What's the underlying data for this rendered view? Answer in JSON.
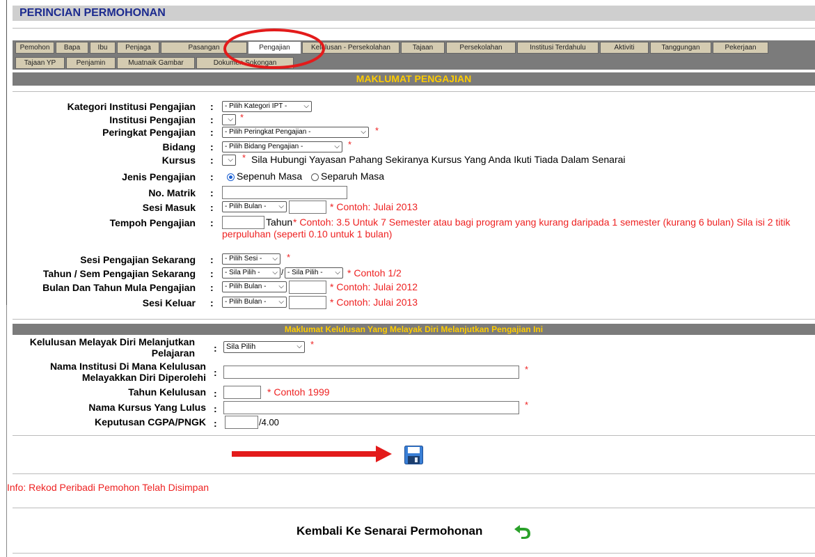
{
  "header": {
    "title": "PERINCIAN PERMOHONAN"
  },
  "tabs": {
    "row1": [
      "Pemohon",
      "Bapa",
      "Ibu",
      "Penjaga",
      "Pasangan",
      "Pengajian",
      "Kelulusan - Persekolahan",
      "Tajaan",
      "Persekolahan",
      "Institusi Terdahulu",
      "Aktiviti",
      "Tanggungan",
      "Pekerjaan"
    ],
    "row2": [
      "Tajaan YP",
      "Penjamin",
      "Muatnaik Gambar",
      "Dokumen Sokongan"
    ],
    "active": "Pengajian"
  },
  "section1": {
    "title": "MAKLUMAT PENGAJIAN",
    "kategori": {
      "label": "Kategori Institusi Pengajian",
      "value": "- Pilih Kategori IPT -"
    },
    "institusi": {
      "label": "Institusi Pengajian",
      "value": ""
    },
    "peringkat": {
      "label": "Peringkat Pengajian",
      "value": "- Pilih Peringkat Pengajian -"
    },
    "bidang": {
      "label": "Bidang",
      "value": "- Pilih Bidang Pengajian -"
    },
    "kursus": {
      "label": "Kursus",
      "value": "",
      "note": "Sila Hubungi Yayasan Pahang Sekiranya Kursus Yang Anda Ikuti Tiada Dalam Senarai"
    },
    "jenis": {
      "label": "Jenis Pengajian",
      "options": [
        "Sepenuh Masa",
        "Separuh Masa"
      ],
      "selected": "Sepenuh Masa"
    },
    "matrik": {
      "label": "No. Matrik",
      "value": ""
    },
    "sesi_masuk": {
      "label": "Sesi Masuk",
      "value": "- Pilih Bulan -",
      "note": "* Contoh: Julai 2013"
    },
    "tempoh": {
      "label": "Tempoh Pengajian",
      "unit": "Tahun",
      "note1": "* Contoh: 3.5 Untuk 7 Semester atau bagi program yang kurang daripada 1 semester (kurang 6 bulan) Sila isi 2 titik",
      "note2": "perpuluhan (seperti 0.10 untuk 1 bulan)"
    },
    "sesi_sekarang": {
      "label": "Sesi Pengajian Sekarang",
      "value": "- Pilih Sesi -"
    },
    "tahun_sem": {
      "label": "Tahun / Sem Pengajian Sekarang",
      "value1": "- Sila Pilih -",
      "value2": "- Sila Pilih -",
      "note": "* Contoh 1/2"
    },
    "bulan_mula": {
      "label": "Bulan Dan Tahun Mula Pengajian",
      "value": "- Pilih Bulan -",
      "note": "* Contoh: Julai 2012"
    },
    "sesi_keluar": {
      "label": "Sesi Keluar",
      "value": "- Pilih Bulan -",
      "note": "* Contoh: Julai 2013"
    }
  },
  "section2": {
    "title": "Maklumat Kelulusan Yang Melayak Diri Melanjutkan Pengajian Ini",
    "kelulusan": {
      "label1": "Kelulusan Melayak Diri Melanjutkan",
      "label2": "Pelajaran",
      "value": "Sila Pilih"
    },
    "nama_institusi": {
      "label1": "Nama Institusi Di Mana Kelulusan",
      "label2": "Melayakkan Diri Diperolehi"
    },
    "tahun_kelulusan": {
      "label": "Tahun Kelulusan",
      "note": "* Contoh 1999"
    },
    "nama_kursus": {
      "label": "Nama Kursus Yang Lulus"
    },
    "cgpa": {
      "label": "Keputusan CGPA/PNGK",
      "suffix": "/4.00"
    }
  },
  "common": {
    "colon": ":",
    "asterisk": "*",
    "slash": "/"
  },
  "info": "Info: Rekod Peribadi Pemohon Telah Disimpan",
  "back": {
    "label": "Kembali Ke Senarai Permohonan"
  },
  "colors": {
    "annotation_red": "#e31b1b",
    "icon_green": "#2aa12a",
    "save_blue": "#3a7fd6"
  },
  "icons": {
    "save": "floppy-disk-icon",
    "back": "undo-arrow-icon"
  }
}
